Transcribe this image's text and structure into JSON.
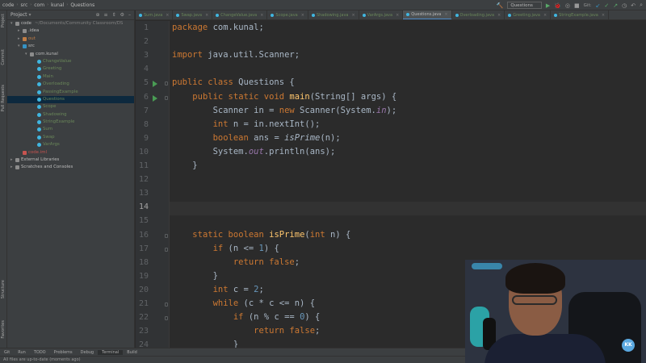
{
  "breadcrumbs": [
    "code",
    "src",
    "com",
    "kunal",
    "Questions"
  ],
  "toolbar": {
    "run_config": "Questions",
    "git_label": "Git:"
  },
  "project_panel": {
    "title": "Project",
    "items": [
      {
        "label": "code",
        "extra": "~/Documents/Community Classroom/DS",
        "indent": 0,
        "kind": "folder"
      },
      {
        "label": ".idea",
        "indent": 1,
        "kind": "folder"
      },
      {
        "label": "out",
        "indent": 1,
        "kind": "folder-orange"
      },
      {
        "label": "src",
        "indent": 1,
        "kind": "folder-blue"
      },
      {
        "label": "com.kunal",
        "indent": 2,
        "kind": "folder"
      },
      {
        "label": "ChangeValue",
        "indent": 3,
        "kind": "class"
      },
      {
        "label": "Greeting",
        "indent": 3,
        "kind": "class"
      },
      {
        "label": "Main",
        "indent": 3,
        "kind": "class"
      },
      {
        "label": "Overloading",
        "indent": 3,
        "kind": "class"
      },
      {
        "label": "PassingExample",
        "indent": 3,
        "kind": "class"
      },
      {
        "label": "Questions",
        "indent": 3,
        "kind": "class",
        "selected": true
      },
      {
        "label": "Scope",
        "indent": 3,
        "kind": "class"
      },
      {
        "label": "Shadowing",
        "indent": 3,
        "kind": "class"
      },
      {
        "label": "StringExample",
        "indent": 3,
        "kind": "class"
      },
      {
        "label": "Sum",
        "indent": 3,
        "kind": "class"
      },
      {
        "label": "Swap",
        "indent": 3,
        "kind": "class"
      },
      {
        "label": "VarArgs",
        "indent": 3,
        "kind": "class"
      },
      {
        "label": "code.iml",
        "indent": 1,
        "kind": "file-red"
      },
      {
        "label": "External Libraries",
        "indent": 0,
        "kind": "folder"
      },
      {
        "label": "Scratches and Consoles",
        "indent": 0,
        "kind": "folder"
      }
    ]
  },
  "tabs": [
    {
      "label": "Sum.java"
    },
    {
      "label": "Swap.java"
    },
    {
      "label": "ChangeValue.java"
    },
    {
      "label": "Scope.java"
    },
    {
      "label": "Shadowing.java"
    },
    {
      "label": "VarArgs.java"
    },
    {
      "label": "Questions.java",
      "active": true
    },
    {
      "label": "Overloading.java"
    },
    {
      "label": "Greeting.java"
    },
    {
      "label": "StringExample.java"
    }
  ],
  "left_stripe": [
    "Project",
    "Commit",
    "Pull Requests",
    "Structure",
    "Favorites"
  ],
  "code_lines": [
    {
      "n": "1",
      "tokens": [
        [
          "kw",
          "package"
        ],
        [
          "p",
          " com.kunal;"
        ]
      ]
    },
    {
      "n": "2",
      "tokens": []
    },
    {
      "n": "3",
      "tokens": [
        [
          "kw",
          "import"
        ],
        [
          "p",
          " java.util.Scanner;"
        ]
      ]
    },
    {
      "n": "4",
      "tokens": []
    },
    {
      "n": "5",
      "run": true,
      "tokens": [
        [
          "kw",
          "public class"
        ],
        [
          "p",
          " Questions {"
        ]
      ]
    },
    {
      "n": "6",
      "run": true,
      "tokens": [
        [
          "p",
          "    "
        ],
        [
          "kw",
          "public static void"
        ],
        [
          "p",
          " "
        ],
        [
          "fn",
          "main"
        ],
        [
          "p",
          "(String[] args) {"
        ]
      ]
    },
    {
      "n": "7",
      "tokens": [
        [
          "p",
          "        Scanner in = "
        ],
        [
          "kw",
          "new"
        ],
        [
          "p",
          " Scanner(System."
        ],
        [
          "fld",
          "in"
        ],
        [
          "p",
          ");"
        ]
      ]
    },
    {
      "n": "8",
      "tokens": [
        [
          "p",
          "        "
        ],
        [
          "kw",
          "int"
        ],
        [
          "p",
          " n = in.nextInt();"
        ]
      ]
    },
    {
      "n": "9",
      "tokens": [
        [
          "p",
          "        "
        ],
        [
          "kw",
          "boolean"
        ],
        [
          "p",
          " ans = "
        ],
        [
          "it",
          "isPrime"
        ],
        [
          "p",
          "(n);"
        ]
      ]
    },
    {
      "n": "10",
      "tokens": [
        [
          "p",
          "        System."
        ],
        [
          "fld",
          "out"
        ],
        [
          "p",
          ".println(ans);"
        ]
      ]
    },
    {
      "n": "11",
      "tokens": [
        [
          "p",
          "    }"
        ]
      ]
    },
    {
      "n": "12",
      "tokens": []
    },
    {
      "n": "13",
      "tokens": []
    },
    {
      "n": "14",
      "current": true,
      "tokens": []
    },
    {
      "n": "15",
      "tokens": []
    },
    {
      "n": "16",
      "tokens": [
        [
          "p",
          "    "
        ],
        [
          "kw",
          "static boolean"
        ],
        [
          "p",
          " "
        ],
        [
          "fn",
          "isPrime"
        ],
        [
          "p",
          "("
        ],
        [
          "kw",
          "int"
        ],
        [
          "p",
          " n) {"
        ]
      ]
    },
    {
      "n": "17",
      "tokens": [
        [
          "p",
          "        "
        ],
        [
          "kw",
          "if"
        ],
        [
          "p",
          " (n <= "
        ],
        [
          "num",
          "1"
        ],
        [
          "p",
          ") {"
        ]
      ]
    },
    {
      "n": "18",
      "tokens": [
        [
          "p",
          "            "
        ],
        [
          "kw",
          "return false"
        ],
        [
          "p",
          ";"
        ]
      ]
    },
    {
      "n": "19",
      "tokens": [
        [
          "p",
          "        }"
        ]
      ]
    },
    {
      "n": "20",
      "tokens": [
        [
          "p",
          "        "
        ],
        [
          "kw",
          "int"
        ],
        [
          "p",
          " c = "
        ],
        [
          "num",
          "2"
        ],
        [
          "p",
          ";"
        ]
      ]
    },
    {
      "n": "21",
      "tokens": [
        [
          "p",
          "        "
        ],
        [
          "kw",
          "while"
        ],
        [
          "p",
          " (c * c <= n) {"
        ]
      ]
    },
    {
      "n": "22",
      "tokens": [
        [
          "p",
          "            "
        ],
        [
          "kw",
          "if"
        ],
        [
          "p",
          " (n % c == "
        ],
        [
          "num",
          "0"
        ],
        [
          "p",
          ") {"
        ]
      ]
    },
    {
      "n": "23",
      "tokens": [
        [
          "p",
          "                "
        ],
        [
          "kw",
          "return false"
        ],
        [
          "p",
          ";"
        ]
      ]
    },
    {
      "n": "24",
      "tokens": [
        [
          "p",
          "            }"
        ]
      ]
    }
  ],
  "bottom_tools": [
    "Git",
    "Run",
    "TODO",
    "Problems",
    "Debug",
    "Terminal",
    "Build"
  ],
  "status_text": "All files are up-to-date (moments ago)",
  "webcam_badge": "KK",
  "colors": {
    "accent": "#4a88c7",
    "run_green": "#499c54",
    "keyword": "#cc7832",
    "function": "#ffc66d"
  }
}
